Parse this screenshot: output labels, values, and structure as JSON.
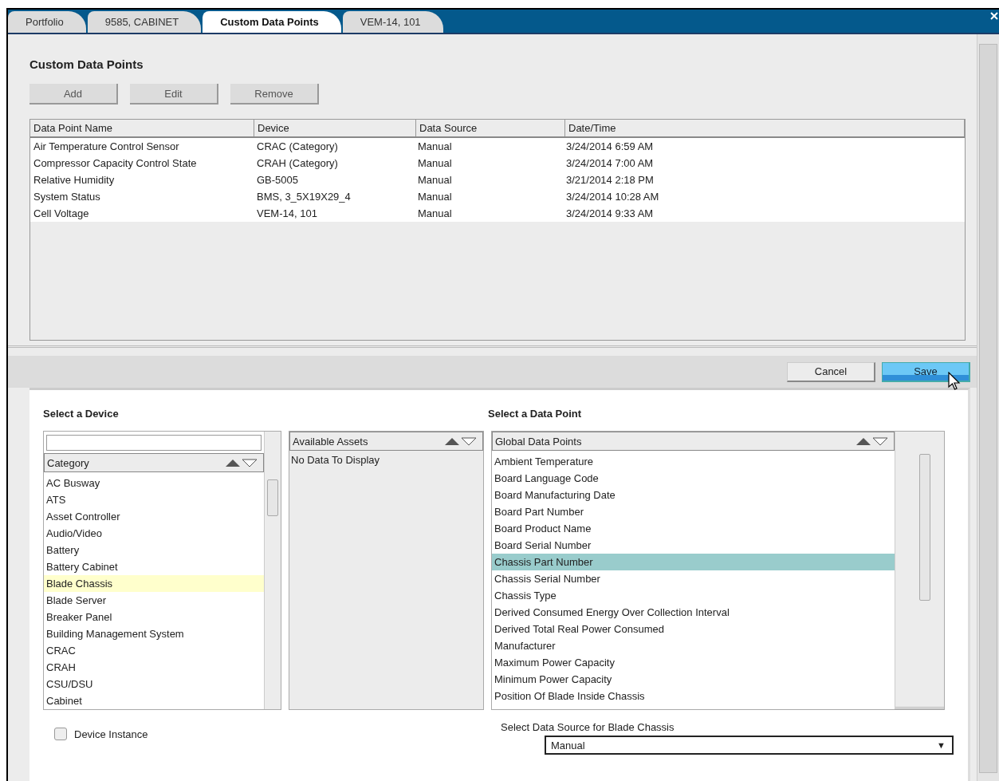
{
  "tabs": [
    {
      "label": "Portfolio",
      "selected": false
    },
    {
      "label": "9585, CABINET",
      "selected": false
    },
    {
      "label": "Custom Data Points",
      "selected": true
    },
    {
      "label": "VEM-14, 101",
      "selected": false
    }
  ],
  "page_title": "Custom Data Points",
  "toolbar": [
    "Add",
    "Edit",
    "Remove"
  ],
  "table": {
    "columns": [
      "Data Point Name",
      "Device",
      "Data Source",
      "Date/Time"
    ],
    "rows": [
      [
        "Air Temperature Control Sensor",
        "CRAC (Category)",
        "Manual",
        "3/24/2014 6:59 AM"
      ],
      [
        "Compressor Capacity Control State",
        "CRAH (Category)",
        "Manual",
        "3/24/2014 7:00 AM"
      ],
      [
        "Relative Humidity",
        "GB-5005",
        "Manual",
        "3/21/2014 2:18 PM"
      ],
      [
        "System Status",
        "BMS, 3_5X19X29_4",
        "Manual",
        "3/24/2014 10:28 AM"
      ],
      [
        "Cell Voltage",
        "VEM-14, 101",
        "Manual",
        "3/24/2014 9:33 AM"
      ]
    ]
  },
  "actions": [
    {
      "label": "Cancel",
      "kind": "secondary"
    },
    {
      "label": "Save",
      "kind": "primary"
    }
  ],
  "device_panel": {
    "heading": "Select a Device",
    "header": "Category",
    "items": [
      {
        "label": "AC Busway",
        "selected": false
      },
      {
        "label": "ATS",
        "selected": false
      },
      {
        "label": "Asset Controller",
        "selected": false
      },
      {
        "label": "Audio/Video",
        "selected": false
      },
      {
        "label": "Battery",
        "selected": false
      },
      {
        "label": "Battery Cabinet",
        "selected": false
      },
      {
        "label": "Blade Chassis",
        "selected": true
      },
      {
        "label": "Blade Server",
        "selected": false
      },
      {
        "label": "Breaker Panel",
        "selected": false
      },
      {
        "label": "Building Management System",
        "selected": false
      },
      {
        "label": "CRAC",
        "selected": false
      },
      {
        "label": "CRAH",
        "selected": false
      },
      {
        "label": "CSU/DSU",
        "selected": false
      },
      {
        "label": "Cabinet",
        "selected": false
      }
    ]
  },
  "assets_panel": {
    "header": "Available Assets",
    "empty_text": "No Data To Display"
  },
  "data_point_panel": {
    "heading": "Select a Data Point",
    "header": "Global Data Points",
    "items": [
      {
        "label": "Ambient Temperature",
        "selected": false
      },
      {
        "label": "Board Language Code",
        "selected": false
      },
      {
        "label": "Board Manufacturing Date",
        "selected": false
      },
      {
        "label": "Board Part Number",
        "selected": false
      },
      {
        "label": "Board Product Name",
        "selected": false
      },
      {
        "label": "Board Serial Number",
        "selected": false
      },
      {
        "label": "Chassis Part Number",
        "selected": true
      },
      {
        "label": "Chassis Serial Number",
        "selected": false
      },
      {
        "label": "Chassis Type",
        "selected": false
      },
      {
        "label": "Derived Consumed Energy Over Collection Interval",
        "selected": false
      },
      {
        "label": "Derived Total Real Power Consumed",
        "selected": false
      },
      {
        "label": "Manufacturer",
        "selected": false
      },
      {
        "label": "Maximum Power Capacity",
        "selected": false
      },
      {
        "label": "Minimum Power Capacity",
        "selected": false
      },
      {
        "label": "Position Of Blade Inside Chassis",
        "selected": false
      }
    ]
  },
  "device_instance": {
    "label": "Device Instance",
    "checked": false
  },
  "data_source": {
    "label": "Select Data Source for Blade Chassis",
    "value": "Manual",
    "arrow": "▼"
  }
}
